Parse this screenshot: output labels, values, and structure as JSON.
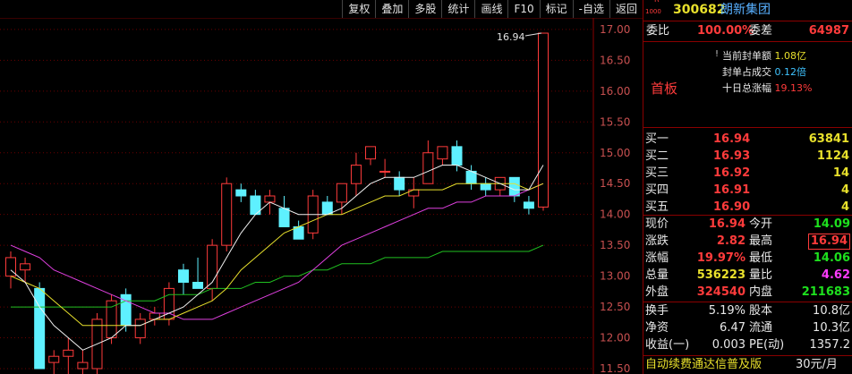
{
  "toolbar": {
    "items": [
      "复权",
      "叠加",
      "多股",
      "统计",
      "画线",
      "F10",
      "标记",
      "-自选",
      "返回"
    ]
  },
  "chart_data": {
    "type": "candlestick",
    "y_ticks": [
      "17.00",
      "16.50",
      "16.00",
      "15.50",
      "15.00",
      "14.50",
      "14.00",
      "13.50",
      "13.00",
      "12.50",
      "12.00",
      "11.50"
    ],
    "ylim": [
      11.5,
      17.1
    ],
    "high_marker": "16.94",
    "candles": [
      {
        "o": 13.0,
        "h": 13.4,
        "l": 12.8,
        "c": 13.3
      },
      {
        "o": 13.1,
        "h": 13.3,
        "l": 12.9,
        "c": 13.2
      },
      {
        "o": 12.8,
        "h": 12.9,
        "l": 11.5,
        "c": 11.5
      },
      {
        "o": 11.6,
        "h": 11.8,
        "l": 11.4,
        "c": 11.7
      },
      {
        "o": 11.7,
        "h": 12.0,
        "l": 11.4,
        "c": 11.8
      },
      {
        "o": 11.5,
        "h": 11.8,
        "l": 11.4,
        "c": 11.6
      },
      {
        "o": 11.5,
        "h": 12.4,
        "l": 11.4,
        "c": 12.3
      },
      {
        "o": 12.0,
        "h": 12.7,
        "l": 11.9,
        "c": 12.6
      },
      {
        "o": 12.7,
        "h": 12.8,
        "l": 12.1,
        "c": 12.2
      },
      {
        "o": 12.0,
        "h": 12.4,
        "l": 11.9,
        "c": 12.3
      },
      {
        "o": 12.3,
        "h": 12.5,
        "l": 12.2,
        "c": 12.4
      },
      {
        "o": 12.3,
        "h": 12.9,
        "l": 12.2,
        "c": 12.8
      },
      {
        "o": 13.1,
        "h": 13.2,
        "l": 12.7,
        "c": 12.9
      },
      {
        "o": 12.9,
        "h": 13.3,
        "l": 12.8,
        "c": 12.8
      },
      {
        "o": 12.8,
        "h": 13.6,
        "l": 12.6,
        "c": 13.5
      },
      {
        "o": 13.5,
        "h": 14.6,
        "l": 13.4,
        "c": 14.5
      },
      {
        "o": 14.4,
        "h": 14.5,
        "l": 14.2,
        "c": 14.3
      },
      {
        "o": 14.3,
        "h": 14.4,
        "l": 14.0,
        "c": 14.0
      },
      {
        "o": 14.2,
        "h": 14.4,
        "l": 14.0,
        "c": 14.3
      },
      {
        "o": 14.1,
        "h": 14.3,
        "l": 13.8,
        "c": 13.8
      },
      {
        "o": 13.8,
        "h": 13.9,
        "l": 13.6,
        "c": 13.6
      },
      {
        "o": 13.7,
        "h": 14.4,
        "l": 13.6,
        "c": 14.3
      },
      {
        "o": 14.2,
        "h": 14.3,
        "l": 14.0,
        "c": 14.0
      },
      {
        "o": 14.2,
        "h": 14.5,
        "l": 14.0,
        "c": 14.5
      },
      {
        "o": 14.5,
        "h": 15.0,
        "l": 14.3,
        "c": 14.8
      },
      {
        "o": 14.9,
        "h": 15.1,
        "l": 14.8,
        "c": 15.1
      },
      {
        "o": 14.7,
        "h": 14.9,
        "l": 14.6,
        "c": 14.7
      },
      {
        "o": 14.6,
        "h": 14.7,
        "l": 14.3,
        "c": 14.4
      },
      {
        "o": 14.3,
        "h": 14.6,
        "l": 14.1,
        "c": 14.4
      },
      {
        "o": 14.5,
        "h": 15.2,
        "l": 14.5,
        "c": 15.0
      },
      {
        "o": 14.9,
        "h": 15.1,
        "l": 14.8,
        "c": 15.1
      },
      {
        "o": 15.1,
        "h": 15.2,
        "l": 14.7,
        "c": 14.8
      },
      {
        "o": 14.7,
        "h": 14.8,
        "l": 14.4,
        "c": 14.5
      },
      {
        "o": 14.5,
        "h": 14.6,
        "l": 14.3,
        "c": 14.4
      },
      {
        "o": 14.4,
        "h": 14.6,
        "l": 14.3,
        "c": 14.6
      },
      {
        "o": 14.6,
        "h": 14.6,
        "l": 14.2,
        "c": 14.3
      },
      {
        "o": 14.2,
        "h": 14.3,
        "l": 14.0,
        "c": 14.1
      },
      {
        "o": 14.12,
        "h": 16.94,
        "l": 14.06,
        "c": 16.94
      }
    ],
    "ma_white": [
      13.1,
      12.9,
      12.5,
      12.2,
      12.0,
      11.8,
      11.9,
      12.0,
      12.2,
      12.2,
      12.3,
      12.4,
      12.5,
      12.7,
      12.9,
      13.3,
      13.7,
      14.0,
      14.2,
      14.1,
      14.0,
      14.0,
      14.0,
      14.1,
      14.3,
      14.5,
      14.6,
      14.6,
      14.6,
      14.7,
      14.8,
      14.8,
      14.7,
      14.6,
      14.5,
      14.4,
      14.4,
      14.8
    ],
    "ma_yellow": [
      13.0,
      12.9,
      12.8,
      12.6,
      12.4,
      12.2,
      12.2,
      12.2,
      12.2,
      12.2,
      12.3,
      12.3,
      12.4,
      12.5,
      12.6,
      12.8,
      13.1,
      13.3,
      13.5,
      13.7,
      13.8,
      13.9,
      14.0,
      14.0,
      14.1,
      14.2,
      14.3,
      14.3,
      14.4,
      14.4,
      14.4,
      14.5,
      14.5,
      14.5,
      14.5,
      14.5,
      14.4,
      14.5
    ],
    "ma_magenta": [
      13.5,
      13.4,
      13.3,
      13.1,
      13.0,
      12.9,
      12.8,
      12.7,
      12.6,
      12.5,
      12.4,
      12.4,
      12.3,
      12.3,
      12.3,
      12.4,
      12.5,
      12.6,
      12.7,
      12.8,
      12.9,
      13.1,
      13.3,
      13.5,
      13.6,
      13.7,
      13.8,
      13.9,
      14.0,
      14.1,
      14.1,
      14.2,
      14.2,
      14.3,
      14.3,
      14.3,
      14.4,
      14.5
    ],
    "ma_green": [
      12.5,
      12.5,
      12.5,
      12.5,
      12.5,
      12.5,
      12.5,
      12.5,
      12.6,
      12.6,
      12.6,
      12.7,
      12.7,
      12.7,
      12.8,
      12.8,
      12.8,
      12.9,
      12.9,
      13.0,
      13.0,
      13.1,
      13.1,
      13.2,
      13.2,
      13.2,
      13.3,
      13.3,
      13.3,
      13.3,
      13.4,
      13.4,
      13.4,
      13.4,
      13.4,
      13.4,
      13.4,
      13.5
    ]
  },
  "colors": {
    "up": "#ff3b3b",
    "down": "#5ef0ff",
    "ma_white": "#f0f0f0",
    "ma_yellow": "#e8e02c",
    "ma_magenta": "#e040e0",
    "ma_green": "#20c020",
    "grid": "#6a0000"
  },
  "panel": {
    "r_badge": "R",
    "r_sub": "1000",
    "code": "300682",
    "name": "朗新集团",
    "weibi_label": "委比",
    "weibi_value": "100.00%",
    "weicha_label": "委差",
    "weicha_value": "64987",
    "board_label": "首板",
    "info": [
      {
        "label": "当前封单额",
        "value": "1.08亿"
      },
      {
        "label": "封单占成交",
        "value": "0.12倍"
      },
      {
        "label": "十日总涨幅",
        "value": "19.13%"
      }
    ],
    "buy": [
      {
        "label": "买一",
        "price": "16.94",
        "vol": "63841"
      },
      {
        "label": "买二",
        "price": "16.93",
        "vol": "1124"
      },
      {
        "label": "买三",
        "price": "16.92",
        "vol": "14"
      },
      {
        "label": "买四",
        "price": "16.91",
        "vol": "4"
      },
      {
        "label": "买五",
        "price": "16.90",
        "vol": "4"
      }
    ],
    "stats": [
      {
        "l1": "现价",
        "v1": "16.94",
        "l2": "今开",
        "v2": "14.09"
      },
      {
        "l1": "涨跌",
        "v1": "2.82",
        "l2": "最高",
        "v2": "16.94"
      },
      {
        "l1": "涨幅",
        "v1": "19.97%",
        "l2": "最低",
        "v2": "14.06"
      },
      {
        "l1": "总量",
        "v1": "536223",
        "l2": "量比",
        "v2": "4.62"
      },
      {
        "l1": "外盘",
        "v1": "324540",
        "l2": "内盘",
        "v2": "211683"
      }
    ],
    "fund": [
      {
        "l1": "换手",
        "v1": "5.19%",
        "l2": "股本",
        "v2": "10.8亿"
      },
      {
        "l1": "净资",
        "v1": "6.47",
        "l2": "流通",
        "v2": "10.3亿"
      },
      {
        "l1": "收益(一)",
        "v1": "0.003",
        "l2": "PE(动)",
        "v2": "1357.2"
      }
    ],
    "banner_text": "自动续费通达信普及版",
    "banner_price": "30元/月"
  }
}
